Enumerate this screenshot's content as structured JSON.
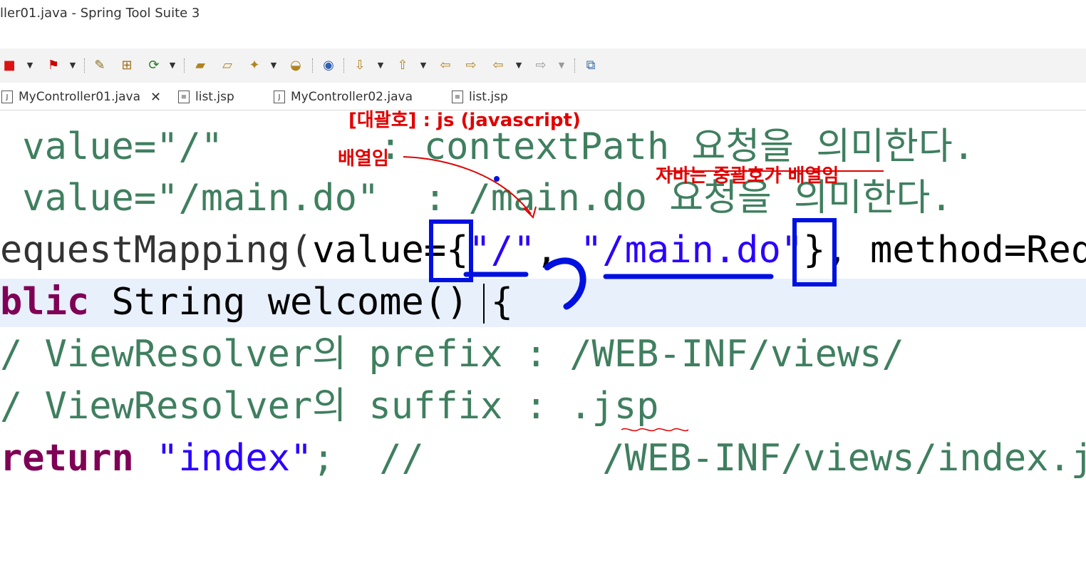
{
  "window": {
    "title": "ller01.java - Spring Tool Suite 3"
  },
  "toolbar": {
    "icons": [
      "stop-icon",
      "debug-icon",
      "new-project-icon",
      "package-icon",
      "run-config-icon",
      "open-folder-icon",
      "open-file-icon",
      "wand-icon",
      "open-type-icon",
      "globe-icon",
      "next-annotation-icon",
      "prev-annotation-icon",
      "back-edit-icon",
      "forward-edit-icon",
      "back-icon",
      "forward-icon",
      "pin-editor-icon"
    ]
  },
  "tabs": [
    {
      "label": "MyController01.java",
      "active": true
    },
    {
      "label": "list.jsp"
    },
    {
      "label": "MyController02.java"
    },
    {
      "label": "list.jsp"
    }
  ],
  "code": {
    "line1": " value=\"/\"       : contextPath 요청을 의미한다.",
    "line2": " value=\"/main.do\"  : /main.do 요청을 의미한다.",
    "line3_a": "equestMapping(",
    "line3_b": "value=",
    "line3_c": "{",
    "line3_d": "\"/\"",
    "line3_e": ", ",
    "line3_f": "\"/main.do\"",
    "line3_g": "}",
    "line3_h": ", method=Req",
    "line4_kw": "blic",
    "line4_rest": " String welcome() {",
    "line5": "/ ViewResolver의 prefix : /WEB-INF/views/",
    "line6": "/ ViewResolver의 suffix : .jsp",
    "line7_kw": "return",
    "line7_str": "\"index\"",
    "line7_rest": ";  //        /WEB-INF/views/index.j"
  },
  "annotations": {
    "bracket_note": "[대괄호] : js (javascript)",
    "array_note": "배열임",
    "java_note": "자바는 중괄호가 배열임"
  },
  "colors": {
    "comment": "#3f7f5f",
    "keyword": "#7f0055",
    "string": "#2a00ff",
    "ink": "#0010e0",
    "note": "#e00000"
  }
}
